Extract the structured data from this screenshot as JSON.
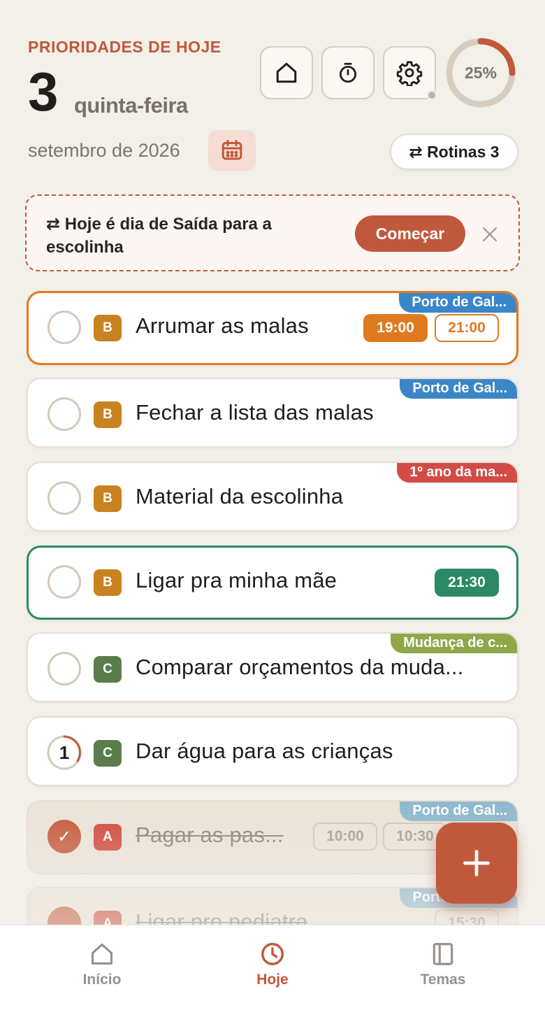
{
  "header": {
    "eyebrow": "PRIORIDADES DE HOJE",
    "day_number": "3",
    "weekday": "quinta-feira",
    "month_year": "setembro de 2026",
    "progress_label": "25%",
    "progress_value": 0.25,
    "routines_label": "⇄ Rotinas 3",
    "icons": [
      "home-icon",
      "timer-icon",
      "settings-icon",
      "calendar-icon"
    ]
  },
  "banner": {
    "text": "⇄ Hoje é dia de Saída para a escolinha",
    "start_label": "Começar"
  },
  "tasks": [
    {
      "title": "Arrumar as malas",
      "priority": "B",
      "tag": "Porto de Gal...",
      "times": [
        "19:00",
        "21:00"
      ]
    },
    {
      "title": "Fechar a lista das malas",
      "priority": "B",
      "tag": "Porto de Gal..."
    },
    {
      "title": "Material da escolinha",
      "priority": "B",
      "tag": "1º ano da ma..."
    },
    {
      "title": "Ligar pra minha mãe",
      "priority": "B",
      "times": [
        "21:30"
      ]
    },
    {
      "title": "Comparar orçamentos da muda...",
      "priority": "C",
      "tag": "Mudança de c..."
    },
    {
      "title": "Dar água para as crianças",
      "priority": "C",
      "counter": "1"
    },
    {
      "title": "Pagar as pas...",
      "priority": "A",
      "tag": "Porto de Gal...",
      "times": [
        "10:00",
        "10:30"
      ],
      "done": true,
      "check": "✓"
    },
    {
      "title": "Ligar pro pediatra",
      "priority": "A",
      "tag": "Porto de Gal...",
      "times": [
        "15:30"
      ],
      "done": true
    }
  ],
  "nav": {
    "items": [
      {
        "label": "Início",
        "icon": "home-icon"
      },
      {
        "label": "Hoje",
        "icon": "clock-icon",
        "active": true
      },
      {
        "label": "Temas",
        "icon": "book-icon"
      }
    ]
  },
  "colors": {
    "accent": "#c0593b",
    "priority_a": "#d0493b",
    "priority_b": "#c8821f",
    "priority_c": "#5b7d4b",
    "tag_blue": "#3b86c9",
    "tag_red": "#d24b47",
    "tag_green": "#8fa848",
    "time_orange": "#e07a1f",
    "time_green": "#2b8a64"
  }
}
